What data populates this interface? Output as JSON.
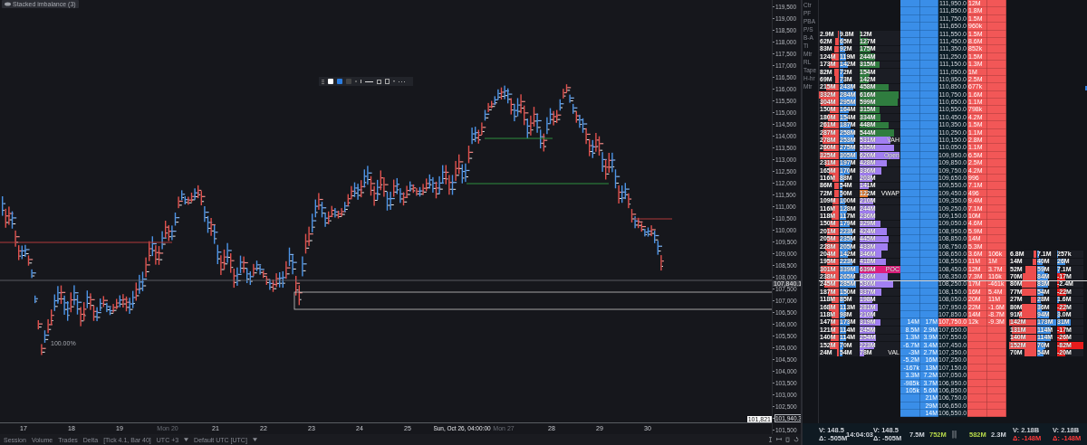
{
  "chart": {
    "indicator_title": "Stacked imbalance (3)",
    "zoom_label": "100.00%",
    "price_axis": [
      {
        "text": "119,500",
        "kind": "tick"
      },
      {
        "text": "119,000",
        "kind": "tick"
      },
      {
        "text": "118,500",
        "kind": "tick"
      },
      {
        "text": "118,000",
        "kind": "tick"
      },
      {
        "text": "117,500",
        "kind": "tick"
      },
      {
        "text": "117,000",
        "kind": "tick"
      },
      {
        "text": "116,500",
        "kind": "tick"
      },
      {
        "text": "116,000",
        "kind": "tick"
      },
      {
        "text": "115,500",
        "kind": "tick"
      },
      {
        "text": "115,000",
        "kind": "tick"
      },
      {
        "text": "114,500",
        "kind": "tick"
      },
      {
        "text": "114,000",
        "kind": "tick"
      },
      {
        "text": "113,500",
        "kind": "tick"
      },
      {
        "text": "113,000",
        "kind": "tick"
      },
      {
        "text": "112,500",
        "kind": "tick"
      },
      {
        "text": "112,000",
        "kind": "tick"
      },
      {
        "text": "111,500",
        "kind": "tick"
      },
      {
        "text": "111,000",
        "kind": "tick"
      },
      {
        "text": "110,500",
        "kind": "tick"
      },
      {
        "text": "110,000",
        "kind": "tick"
      },
      {
        "text": "109,500",
        "kind": "tick"
      },
      {
        "text": "109,000",
        "kind": "tick"
      },
      {
        "text": "108,500",
        "kind": "tick"
      },
      {
        "text": "108,000",
        "kind": "tick"
      },
      {
        "text": "107,500",
        "kind": "tick"
      },
      {
        "text": "107,000",
        "kind": "tick"
      },
      {
        "text": "106,500",
        "kind": "tick"
      },
      {
        "text": "106,000",
        "kind": "tick"
      },
      {
        "text": "105,500",
        "kind": "tick"
      },
      {
        "text": "105,000",
        "kind": "tick"
      },
      {
        "text": "104,500",
        "kind": "tick"
      },
      {
        "text": "104,000",
        "kind": "tick"
      },
      {
        "text": "103,500",
        "kind": "tick"
      },
      {
        "text": "103,000",
        "kind": "tick"
      },
      {
        "text": "102,500",
        "kind": "tick"
      },
      {
        "text": "101,940.3",
        "kind": "cursor"
      },
      {
        "text": "101,500",
        "kind": "tick"
      }
    ],
    "last_price_marker": "107,840.1",
    "price_tag": "101,821",
    "dates": [
      {
        "text": "17",
        "kind": "day"
      },
      {
        "text": "18",
        "kind": "day"
      },
      {
        "text": "19",
        "kind": "day"
      },
      {
        "text": "Mon 20",
        "kind": "week"
      },
      {
        "text": "21",
        "kind": "day"
      },
      {
        "text": "22",
        "kind": "day"
      },
      {
        "text": "23",
        "kind": "day"
      },
      {
        "text": "24",
        "kind": "day"
      },
      {
        "text": "25",
        "kind": "day"
      },
      {
        "text": "Sun, Oct 26, 04:00:00",
        "kind": "cursor"
      },
      {
        "text": "Mon 27",
        "kind": "week"
      },
      {
        "text": "28",
        "kind": "day"
      },
      {
        "text": "29",
        "kind": "day"
      },
      {
        "text": "30",
        "kind": "day"
      }
    ],
    "footer": [
      {
        "text": "Session",
        "dropdown": false
      },
      {
        "text": "Volume",
        "dropdown": false
      },
      {
        "text": "Trades",
        "dropdown": false
      },
      {
        "text": "Delta",
        "dropdown": false
      },
      {
        "text": "[Tick 4.1, Bar 40]",
        "dropdown": false
      },
      {
        "text": "UTC +3",
        "dropdown": true
      },
      {
        "text": "Default UTC [UTC]",
        "dropdown": true
      }
    ]
  },
  "dom": {
    "toolbar": [
      "Ctr",
      "PF",
      "PBA",
      "P/S",
      "B-A",
      "Ti",
      "Mtr",
      "RL",
      "Tape",
      "H-hr",
      "Mtr"
    ],
    "rows": [
      {
        "price": "111,950.0",
        "last": false,
        "ask": "12M"
      },
      {
        "price": "111,850.0",
        "last": false,
        "ask": "1.8M"
      },
      {
        "price": "111,750.0",
        "last": false,
        "ask": "1.5M"
      },
      {
        "price": "111,650.0",
        "last": false,
        "ask": "960k"
      },
      {
        "price": "111,550.0",
        "last": false,
        "ask": "1.5M",
        "sell": {
          "text": "2.9M",
          "level": 0.03
        },
        "buy": {
          "text": "9.8M",
          "level": 0.03
        },
        "total": {
          "text": "12M",
          "level": 0.02
        },
        "kind": "outside"
      },
      {
        "price": "111,450.0",
        "last": false,
        "ask": "8.6M",
        "sell": {
          "text": "62M",
          "level": 0.18
        },
        "buy": {
          "text": "65M",
          "level": 0.19
        },
        "total": {
          "text": "127M",
          "level": 0.2
        },
        "kind": "outside"
      },
      {
        "price": "111,350.0",
        "last": false,
        "ask": "852k",
        "sell": {
          "text": "83M",
          "level": 0.24
        },
        "buy": {
          "text": "92M",
          "level": 0.27
        },
        "total": {
          "text": "175M",
          "level": 0.27
        },
        "kind": "outside"
      },
      {
        "price": "111,250.0",
        "last": false,
        "ask": "1.5M",
        "sell": {
          "text": "124M",
          "level": 0.36
        },
        "buy": {
          "text": "119M",
          "level": 0.35
        },
        "total": {
          "text": "244M",
          "level": 0.38
        },
        "kind": "outside"
      },
      {
        "price": "111,150.0",
        "last": false,
        "ask": "1.3M",
        "sell": {
          "text": "173M",
          "level": 0.51
        },
        "buy": {
          "text": "142M",
          "level": 0.42
        },
        "total": {
          "text": "315M",
          "level": 0.49
        },
        "kind": "outside"
      },
      {
        "price": "111,050.0",
        "last": false,
        "ask": "1M",
        "sell": {
          "text": "82M",
          "level": 0.24
        },
        "buy": {
          "text": "72M",
          "level": 0.21
        },
        "total": {
          "text": "154M",
          "level": 0.24
        },
        "kind": "outside"
      },
      {
        "price": "110,950.0",
        "last": false,
        "ask": "2.5M",
        "sell": {
          "text": "69M",
          "level": 0.2
        },
        "buy": {
          "text": "73M",
          "level": 0.21
        },
        "total": {
          "text": "142M",
          "level": 0.22
        },
        "kind": "outside"
      },
      {
        "price": "110,850.0",
        "last": false,
        "ask": "677k",
        "sell": {
          "text": "215M",
          "level": 0.63
        },
        "buy": {
          "text": "243M",
          "level": 0.72
        },
        "total": {
          "text": "458M",
          "level": 0.72
        },
        "kind": "outside"
      },
      {
        "price": "110,750.0",
        "last": false,
        "ask": "1.6M",
        "sell": {
          "text": "332M",
          "level": 0.98
        },
        "buy": {
          "text": "284M",
          "level": 0.84
        },
        "total": {
          "text": "616M",
          "level": 0.96
        },
        "kind": "outside"
      },
      {
        "price": "110,650.0",
        "last": false,
        "ask": "1.1M",
        "sell": {
          "text": "304M",
          "level": 0.89
        },
        "buy": {
          "text": "295M",
          "level": 0.87
        },
        "total": {
          "text": "599M",
          "level": 0.94
        },
        "kind": "outside"
      },
      {
        "price": "110,550.0",
        "last": false,
        "ask": "798k",
        "sell": {
          "text": "150M",
          "level": 0.44
        },
        "buy": {
          "text": "164M",
          "level": 0.48
        },
        "total": {
          "text": "315M",
          "level": 0.49
        },
        "kind": "outside"
      },
      {
        "price": "110,450.0",
        "last": false,
        "ask": "4.2M",
        "sell": {
          "text": "180M",
          "level": 0.53
        },
        "buy": {
          "text": "154M",
          "level": 0.45
        },
        "total": {
          "text": "334M",
          "level": 0.52
        },
        "kind": "outside"
      },
      {
        "price": "110,350.0",
        "last": false,
        "ask": "1.5M",
        "sell": {
          "text": "261M",
          "level": 0.77
        },
        "buy": {
          "text": "187M",
          "level": 0.55
        },
        "total": {
          "text": "448M",
          "level": 0.7
        },
        "kind": "outside"
      },
      {
        "price": "110,250.0",
        "last": false,
        "ask": "1.1M",
        "sell": {
          "text": "287M",
          "level": 0.84
        },
        "buy": {
          "text": "258M",
          "level": 0.76
        },
        "total": {
          "text": "544M",
          "level": 0.85
        },
        "kind": "outside"
      },
      {
        "price": "110,150.0",
        "last": false,
        "ask": "2.8M",
        "sell": {
          "text": "278M",
          "level": 0.82
        },
        "buy": {
          "text": "253M",
          "level": 0.74
        },
        "total": {
          "text": "531M",
          "level": 0.75
        },
        "kind": "value_area",
        "marker": "VAH"
      },
      {
        "price": "110,050.0",
        "last": false,
        "ask": "1.1M",
        "sell": {
          "text": "260M",
          "level": 0.76
        },
        "buy": {
          "text": "275M",
          "level": 0.81
        },
        "total": {
          "text": "535M",
          "level": 0.84
        },
        "kind": "value_area"
      },
      {
        "price": "109,950.0",
        "last": false,
        "ask": "6.5M",
        "sell": {
          "text": "325M",
          "level": 0.96
        },
        "buy": {
          "text": "305M",
          "level": 0.9
        },
        "total": {
          "text": "620M",
          "level": 0.97
        },
        "kind": "value_area",
        "marker": "Open"
      },
      {
        "price": "109,850.0",
        "last": false,
        "ask": "2.5M",
        "sell": {
          "text": "231M",
          "level": 0.68
        },
        "buy": {
          "text": "197M",
          "level": 0.58
        },
        "total": {
          "text": "428M",
          "level": 0.67
        },
        "kind": "value_area"
      },
      {
        "price": "109,750.0",
        "last": false,
        "ask": "4.2M",
        "sell": {
          "text": "165M",
          "level": 0.49
        },
        "buy": {
          "text": "170M",
          "level": 0.5
        },
        "total": {
          "text": "336M",
          "level": 0.53
        },
        "kind": "value_area"
      },
      {
        "price": "109,650.0",
        "last": false,
        "ask": "996",
        "sell": {
          "text": "116M",
          "level": 0.34
        },
        "buy": {
          "text": "88M",
          "level": 0.26
        },
        "total": {
          "text": "203M",
          "level": 0.32
        },
        "kind": "value_area"
      },
      {
        "price": "109,550.0",
        "last": false,
        "ask": "7.1M",
        "sell": {
          "text": "86M",
          "level": 0.25
        },
        "buy": {
          "text": "54M",
          "level": 0.16
        },
        "total": {
          "text": "141M",
          "level": 0.22
        },
        "kind": "value_area"
      },
      {
        "price": "109,450.0",
        "last": false,
        "ask": "496",
        "sell": {
          "text": "72M",
          "level": 0.21
        },
        "buy": {
          "text": "50M",
          "level": 0.15
        },
        "total": {
          "text": "122M",
          "level": 0.19
        },
        "kind": "vwap",
        "marker": "VWAP"
      },
      {
        "price": "109,350.0",
        "last": false,
        "ask": "9.4M",
        "sell": {
          "text": "109M",
          "level": 0.32
        },
        "buy": {
          "text": "100M",
          "level": 0.29
        },
        "total": {
          "text": "210M",
          "level": 0.33
        },
        "kind": "value_area"
      },
      {
        "price": "109,250.0",
        "last": false,
        "ask": "7.1M",
        "sell": {
          "text": "116M",
          "level": 0.34
        },
        "buy": {
          "text": "128M",
          "level": 0.38
        },
        "total": {
          "text": "244M",
          "level": 0.38
        },
        "kind": "value_area"
      },
      {
        "price": "109,150.0",
        "last": false,
        "ask": "10M",
        "sell": {
          "text": "118M",
          "level": 0.35
        },
        "buy": {
          "text": "117M",
          "level": 0.34
        },
        "total": {
          "text": "236M",
          "level": 0.37
        },
        "kind": "value_area"
      },
      {
        "price": "109,050.0",
        "last": false,
        "ask": "4.6M",
        "sell": {
          "text": "150M",
          "level": 0.44
        },
        "buy": {
          "text": "179M",
          "level": 0.53
        },
        "total": {
          "text": "329M",
          "level": 0.51
        },
        "kind": "value_area"
      },
      {
        "price": "108,950.0",
        "last": false,
        "ask": "5.9M",
        "sell": {
          "text": "201M",
          "level": 0.59
        },
        "buy": {
          "text": "223M",
          "level": 0.66
        },
        "total": {
          "text": "424M",
          "level": 0.66
        },
        "kind": "value_area"
      },
      {
        "price": "108,850.0",
        "last": false,
        "ask": "14M",
        "sell": {
          "text": "205M",
          "level": 0.6
        },
        "buy": {
          "text": "235M",
          "level": 0.69
        },
        "total": {
          "text": "445M",
          "level": 0.7
        },
        "kind": "value_area"
      },
      {
        "price": "108,750.0",
        "last": false,
        "ask": "5.3M",
        "sell": {
          "text": "228M",
          "level": 0.67
        },
        "buy": {
          "text": "205M",
          "level": 0.6
        },
        "total": {
          "text": "433M",
          "level": 0.68
        },
        "kind": "value_area"
      },
      {
        "price": "108,650.0",
        "last": false,
        "ask": "3.6M",
        "ask_2": "106k",
        "sell": {
          "text": "204M",
          "level": 0.6
        },
        "buy": {
          "text": "142M",
          "level": 0.42
        },
        "total": {
          "text": "346M",
          "level": 0.54
        },
        "kind": "value_area",
        "right": [
          {
            "text": "6.8M",
            "level": 0.1
          },
          {
            "text": "7.1M",
            "level": 0.1
          },
          {
            "text": "257k",
            "level": 0.05,
            "color": "#3a8ee6"
          }
        ]
      },
      {
        "price": "108,550.0",
        "last": false,
        "ask": "11M",
        "ask_2": "1M",
        "sell": {
          "text": "195M",
          "level": 0.57
        },
        "buy": {
          "text": "223M",
          "level": 0.66
        },
        "total": {
          "text": "418M",
          "level": 0.65
        },
        "kind": "value_area",
        "right": [
          {
            "text": "14M",
            "level": 0.15
          },
          {
            "text": "40M",
            "level": 0.3
          },
          {
            "text": "26M",
            "level": 0.3,
            "color": "#3a8ee6"
          }
        ]
      },
      {
        "price": "108,450.0",
        "last": false,
        "ask": "12M",
        "ask_2": "3.7M",
        "sell": {
          "text": "301M",
          "level": 0.89
        },
        "buy": {
          "text": "339M",
          "level": 1
        },
        "total": {
          "text": "639M",
          "level": 1
        },
        "kind": "poc",
        "marker": "POC",
        "right": [
          {
            "text": "52M",
            "level": 0.4
          },
          {
            "text": "59M",
            "level": 0.4
          },
          {
            "text": "7.1M",
            "level": 0.1,
            "color": "#3a8ee6"
          }
        ]
      },
      {
        "price": "108,350.0",
        "last": false,
        "ask": "7.3M",
        "ask_2": "116k",
        "sell": {
          "text": "238M",
          "level": 0.7
        },
        "buy": {
          "text": "265M",
          "level": 0.78
        },
        "total": {
          "text": "436M",
          "level": 0.68
        },
        "kind": "value_area",
        "right": [
          {
            "text": "70M",
            "level": 0.5
          },
          {
            "text": "84M",
            "level": 0.55
          },
          {
            "text": "-17M",
            "level": 0.3,
            "color": "#e81c1c"
          }
        ]
      },
      {
        "price": "108,250.0",
        "last": false,
        "ask": "17M",
        "ask_2": "-461k",
        "sell": {
          "text": "245M",
          "level": 0.72
        },
        "buy": {
          "text": "285M",
          "level": 0.84
        },
        "total": {
          "text": "530M",
          "level": 0.83
        },
        "kind": "value_area",
        "right": [
          {
            "text": "80M",
            "level": 0.55
          },
          {
            "text": "83M",
            "level": 0.55
          },
          {
            "text": "-2.4M",
            "level": 0.08,
            "color": "#e81c1c"
          }
        ]
      },
      {
        "price": "108,150.0",
        "last": false,
        "ask": "16M",
        "ask_2": "5.4M",
        "sell": {
          "text": "187M",
          "level": 0.55
        },
        "buy": {
          "text": "150M",
          "level": 0.44
        },
        "total": {
          "text": "337M",
          "level": 0.53
        },
        "kind": "value_area",
        "right": [
          {
            "text": "77M",
            "level": 0.55
          },
          {
            "text": "54M",
            "level": 0.35
          },
          {
            "text": "-22M",
            "level": 0.35,
            "color": "#e81c1c"
          }
        ]
      },
      {
        "price": "108,050.0",
        "last": false,
        "ask": "20M",
        "ask_2": "11M",
        "sell": {
          "text": "118M",
          "level": 0.35
        },
        "buy": {
          "text": "85M",
          "level": 0.25
        },
        "total": {
          "text": "198M",
          "level": 0.31
        },
        "kind": "value_area",
        "right": [
          {
            "text": "27M",
            "level": 0.2
          },
          {
            "text": "28M",
            "level": 0.2
          },
          {
            "text": "1.6M",
            "level": 0.08,
            "color": "#3a8ee6"
          }
        ]
      },
      {
        "price": "107,950.0",
        "last": false,
        "ask": "22M",
        "ask_2": "-1.6M",
        "sell": {
          "text": "168M",
          "level": 0.49
        },
        "buy": {
          "text": "113M",
          "level": 0.33
        },
        "total": {
          "text": "281M",
          "level": 0.44
        },
        "kind": "value_area",
        "right": [
          {
            "text": "80M",
            "level": 0.55
          },
          {
            "text": "36M",
            "level": 0.25
          },
          {
            "text": "-22M",
            "level": 0.35,
            "color": "#e81c1c"
          }
        ]
      },
      {
        "price": "107,850.0",
        "last": false,
        "ask": "14M",
        "ask_2": "-8.7M",
        "sell": {
          "text": "118M",
          "level": 0.35
        },
        "buy": {
          "text": "98M",
          "level": 0.29
        },
        "total": {
          "text": "210M",
          "level": 0.33
        },
        "kind": "value_area",
        "right": [
          {
            "text": "91M",
            "level": 0.65
          },
          {
            "text": "94M",
            "level": 0.6
          },
          {
            "text": "3.0M",
            "level": 0.1,
            "color": "#3a8ee6"
          }
        ]
      },
      {
        "price": "107,750.0",
        "last": true,
        "ask": "12k",
        "ask_2": "-9.3M",
        "bid": "14M",
        "bid_2": "17M",
        "sell": {
          "text": "147M",
          "level": 0.43
        },
        "buy": {
          "text": "173M",
          "level": 0.51
        },
        "total": {
          "text": "319M",
          "level": 0.5
        },
        "kind": "value_area",
        "right": [
          {
            "text": "142M",
            "level": 1
          },
          {
            "text": "173M",
            "level": 1
          },
          {
            "text": "31M",
            "level": 0.5,
            "color": "#3a8ee6"
          }
        ]
      },
      {
        "price": "107,650.0",
        "last": false,
        "bid": "8.5M",
        "bid_2": "2.9M",
        "sell": {
          "text": "121M",
          "level": 0.36
        },
        "buy": {
          "text": "114M",
          "level": 0.34
        },
        "total": {
          "text": "245M",
          "level": 0.38
        },
        "kind": "value_area",
        "right": [
          {
            "text": "131M",
            "level": 0.9
          },
          {
            "text": "114M",
            "level": 0.7
          },
          {
            "text": "-17M",
            "level": 0.3,
            "color": "#e81c1c"
          }
        ]
      },
      {
        "price": "107,550.0",
        "last": false,
        "bid": "1.3M",
        "bid_2": "3.9M",
        "sell": {
          "text": "140M",
          "level": 0.41
        },
        "buy": {
          "text": "114M",
          "level": 0.34
        },
        "total": {
          "text": "254M",
          "level": 0.4
        },
        "kind": "value_area",
        "right": [
          {
            "text": "140M",
            "level": 0.95
          },
          {
            "text": "114M",
            "level": 0.7
          },
          {
            "text": "-26M",
            "level": 0.4,
            "color": "#e81c1c"
          }
        ]
      },
      {
        "price": "107,450.0",
        "last": false,
        "bid": "-6.7M",
        "bid_2": "3.4M",
        "sell": {
          "text": "152M",
          "level": 0.45
        },
        "buy": {
          "text": "70M",
          "level": 0.21
        },
        "total": {
          "text": "223M",
          "level": 0.35
        },
        "kind": "value_area",
        "right": [
          {
            "text": "152M",
            "level": 1
          },
          {
            "text": "70M",
            "level": 0.45
          },
          {
            "text": "-82M",
            "level": 1,
            "color": "#e81c1c"
          }
        ]
      },
      {
        "price": "107,350.0",
        "last": false,
        "bid": "-3M",
        "bid_2": "2.7M",
        "sell": {
          "text": "24M",
          "level": 0.07
        },
        "buy": {
          "text": "54M",
          "level": 0.16
        },
        "total": {
          "text": "78M",
          "level": 0.12
        },
        "kind": "value_area",
        "marker": "VAL",
        "right": [
          {
            "text": "70M",
            "level": 0.45
          },
          {
            "text": "54M",
            "level": 0.35
          },
          {
            "text": "-20M",
            "level": 0.3,
            "color": "#e81c1c"
          }
        ]
      },
      {
        "price": "107,250.0",
        "last": false,
        "bid": "-5.2M",
        "bid_2": "16M"
      },
      {
        "price": "107,150.0",
        "last": false,
        "bid": "-167k",
        "bid_2": "13M"
      },
      {
        "price": "107,050.0",
        "last": false,
        "bid": "3.3M",
        "bid_2": "7.2M"
      },
      {
        "price": "106,950.0",
        "last": false,
        "bid": "-985k",
        "bid_2": "3.7M"
      },
      {
        "price": "106,850.0",
        "last": false,
        "bid": "105k",
        "bid_2": "5.6M"
      },
      {
        "price": "106,750.0",
        "last": false,
        "bid_2": "21M"
      },
      {
        "price": "106,650.0",
        "last": false,
        "bid_2": "29M"
      },
      {
        "price": "106,550.0",
        "last": false,
        "bid_2": "14M"
      }
    ],
    "footer": [
      {
        "lines": [
          {
            "text": "V: 148.5",
            "color": "#cfd3da"
          },
          {
            "text": "Δ: -505M",
            "color": "#cfd3da"
          }
        ]
      },
      {
        "lines": [
          {
            "text": "14:04:03",
            "color": "#cfd3da"
          }
        ]
      },
      {
        "lines": [
          {
            "text": "V: 148.5",
            "color": "#cfd3da"
          },
          {
            "text": "Δ: -505M",
            "color": "#cfd3da"
          }
        ]
      },
      {
        "lines": [
          {
            "text": "7.5M",
            "color": "#cfd3da"
          }
        ]
      },
      {
        "lines": [
          {
            "text": "752M",
            "color": "#b6d84a"
          }
        ]
      },
      {
        "lines": [
          {
            "text": "582M",
            "color": "#b6d84a"
          }
        ]
      },
      {
        "lines": [
          {
            "text": "2.3M",
            "color": "#cfd3da"
          }
        ]
      },
      {
        "lines": [
          {
            "text": "V: 2.18B",
            "color": "#cfd3da"
          },
          {
            "text": "Δ: -148M",
            "color": "#ff3b3b"
          }
        ]
      },
      {
        "lines": [
          {
            "text": "V: 2.18B",
            "color": "#cfd3da"
          },
          {
            "text": "Δ: -148M",
            "color": "#ff3b3b"
          }
        ]
      }
    ]
  }
}
